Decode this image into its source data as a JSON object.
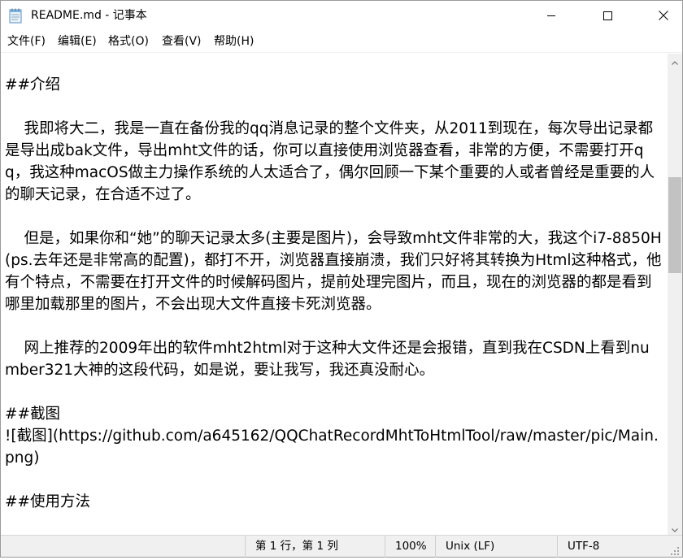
{
  "window": {
    "title": "README.md - 记事本",
    "icons": {
      "app": "notepad-icon",
      "minimize": "minimize-icon",
      "maximize": "maximize-icon",
      "close": "close-icon"
    }
  },
  "menu": {
    "items": [
      {
        "label": "文件(F)"
      },
      {
        "label": "编辑(E)"
      },
      {
        "label": "格式(O)"
      },
      {
        "label": "查看(V)"
      },
      {
        "label": "帮助(H)"
      }
    ]
  },
  "editor": {
    "content": "##介绍\n\n    我即将大二，我是一直在备份我的qq消息记录的整个文件夹，从2011到现在，每次导出记录都是导出成bak文件，导出mht文件的话，你可以直接使用浏览器查看，非常的方便，不需要打开qq，我这种macOS做主力操作系统的人太适合了，偶尔回顾一下某个重要的人或者曾经是重要的人的聊天记录，在合适不过了。\n\n    但是，如果你和“她”的聊天记录太多(主要是图片)，会导致mht文件非常的大，我这个i7-8850H(ps.去年还是非常高的配置)，都打不开，浏览器直接崩溃，我们只好将其转换为Html这种格式，他有个特点，不需要在打开文件的时候解码图片，提前处理完图片，而且，现在的浏览器的都是看到哪里加载那里的图片，不会出现大文件直接卡死浏览器。\n\n    网上推荐的2009年出的软件mht2html对于这种大文件还是会报错，直到我在CSDN上看到number321大神的这段代码，如是说，要让我写，我还真没耐心。\n\n##截图\n![截图](https://github.com/a645162/QQChatRecordMhtToHtmlTool/raw/master/pic/Main.png)\n\n##使用方法"
  },
  "status": {
    "position": "第 1 行，第 1 列",
    "zoom": "100%",
    "line_ending": "Unix (LF)",
    "encoding": "UTF-8"
  }
}
